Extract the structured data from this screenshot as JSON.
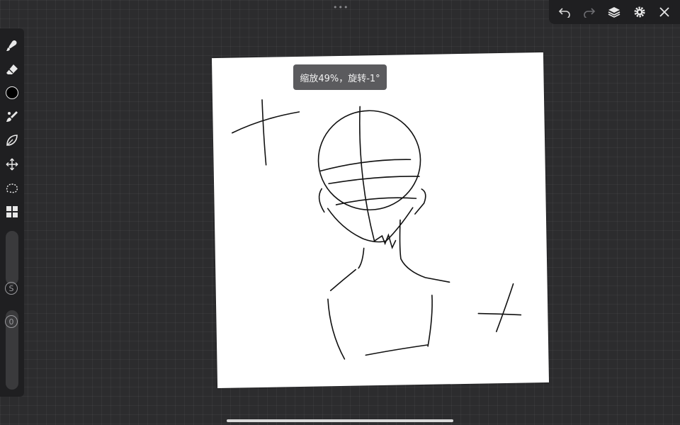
{
  "hud": {
    "zoom_rotate_text": "缩放49%，旋转-1°"
  },
  "top_dots": "•••",
  "toolbar": {
    "undo_icon": "undo-icon",
    "redo_icon": "redo-icon",
    "layers_icon": "layers-icon",
    "settings_icon": "gear-icon",
    "close_icon": "close-icon"
  },
  "left_tools": {
    "size_label": "S",
    "opacity_label": "0"
  },
  "colors": {
    "accent": "#ffffff",
    "panel": "#1f1f21",
    "grid_bg": "#2c2c2e",
    "paper": "#ffffff",
    "stroke": "#111111"
  }
}
